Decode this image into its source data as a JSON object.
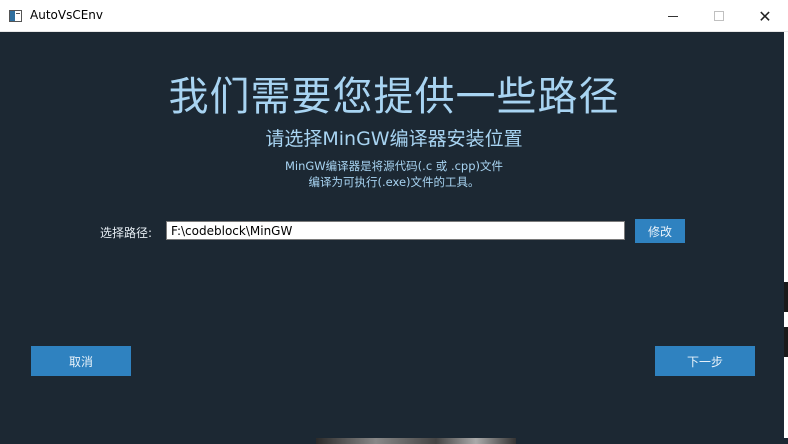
{
  "window": {
    "title": "AutoVsCEnv",
    "minimize_icon": "minimize-icon",
    "maximize_icon": "maximize-icon",
    "close_icon": "close-icon"
  },
  "main": {
    "headline": "我们需要您提供一些路径",
    "subheadline": "请选择MinGW编译器安装位置",
    "description_line1": "MinGW编译器是将源代码(.c 或 .cpp)文件",
    "description_line2": "编译为可执行(.exe)文件的工具。"
  },
  "path": {
    "label": "选择路径:",
    "value": "F:\\codeblock\\MinGW",
    "modify_label": "修改"
  },
  "footer": {
    "cancel_label": "取消",
    "next_label": "下一步"
  },
  "colors": {
    "background": "#1c2833",
    "accent_text": "#a8d4f2",
    "button": "#2f82c0"
  }
}
